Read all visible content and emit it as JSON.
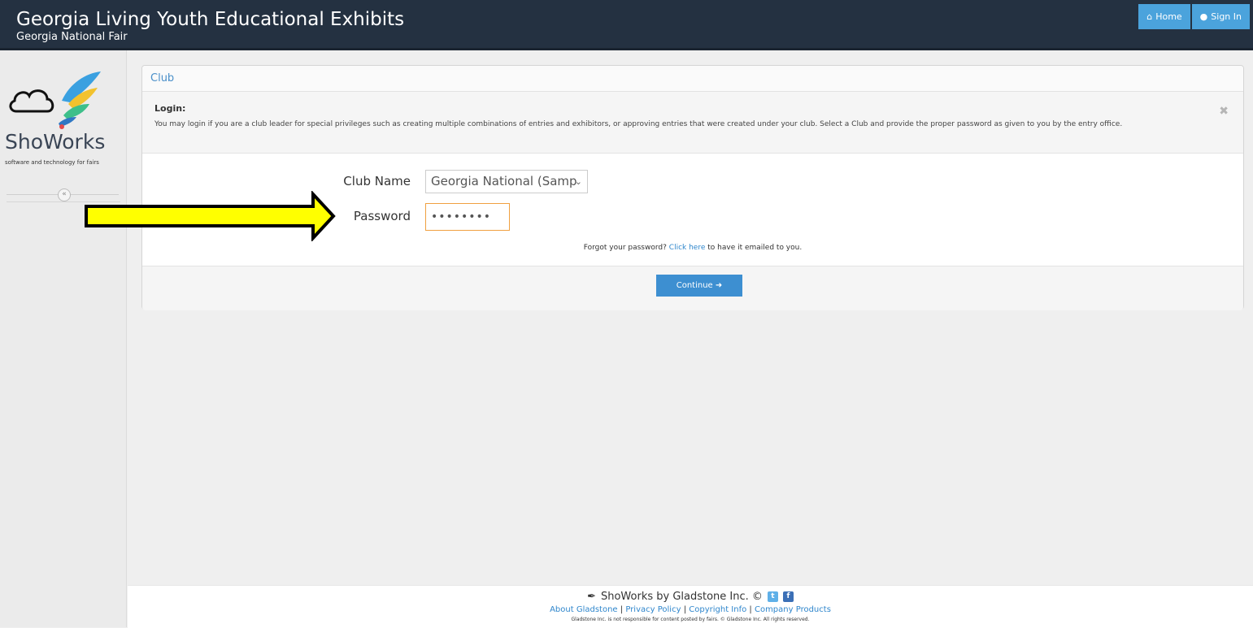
{
  "header": {
    "title": "Georgia Living Youth Educational Exhibits",
    "subtitle": "Georgia National Fair",
    "nav": [
      {
        "label": "Home",
        "icon": "home-icon"
      },
      {
        "label": "Sign In",
        "icon": "user-icon"
      }
    ]
  },
  "sidebar": {
    "brand": "ShoWorks",
    "tagline": "software and technology for fairs"
  },
  "panel": {
    "heading": "Club",
    "alert": {
      "title": "Login:",
      "text": "You may login if you are a club leader for special privileges such as creating multiple combinations of entries and exhibitors, or approving entries that were created under your club. Select a Club and provide the proper password as given to you by the entry office."
    },
    "club_label": "Club Name",
    "club_value": "Georgia National (Samp",
    "password_label": "Password",
    "password_value": "••••••••",
    "forgot_prefix": "Forgot your password?",
    "forgot_link": "Click here",
    "forgot_suffix": "to have it emailed to you.",
    "continue_label": "Continue"
  },
  "footer": {
    "brand_line": "ShoWorks by Gladstone Inc. ©",
    "links": [
      "About Gladstone",
      "Privacy Policy",
      "Copyright Info",
      "Company Products"
    ],
    "disclaimer": "Gladstone Inc. is not responsible for content posted by fairs. © Gladstone Inc. All rights reserved."
  },
  "colors": {
    "header_bg": "#243141",
    "nav_button": "#4ba3dc",
    "continue_button": "#3d8fd1",
    "arrow_fill": "#ffff00",
    "password_border": "#f0a040",
    "twitter": "#5fb0e8",
    "facebook": "#3b6fb6"
  }
}
